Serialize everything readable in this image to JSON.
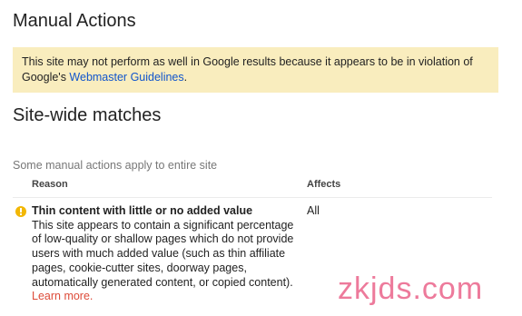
{
  "manual_actions": {
    "title": "Manual Actions",
    "warning": {
      "text_before": "This site may not perform as well in Google results because it appears to be in violation of Google's ",
      "link": "Webmaster Guidelines",
      "text_after": "."
    }
  },
  "site_wide": {
    "title": "Site-wide matches",
    "subtitle": "Some manual actions apply to entire site",
    "table": {
      "headers": {
        "reason": "Reason",
        "affects": "Affects"
      },
      "rows": [
        {
          "icon": "warning-icon",
          "reason_title": "Thin content with little or no added value",
          "reason_body": "This site appears to contain a significant percentage of low-quality or shallow pages which do not provide users with much added value (such as thin affiliate pages, cookie-cutter sites, doorway pages, automatically generated content, or copied content). ",
          "learn_more": "Learn more.",
          "affects": "All"
        }
      ]
    }
  },
  "watermark": "zkjds.com",
  "colors": {
    "warning_bg": "#f9edbe",
    "link_blue": "#1155cc",
    "link_red": "#dd4b39",
    "icon_yellow": "#f2b705",
    "watermark": "#ec6c91"
  }
}
